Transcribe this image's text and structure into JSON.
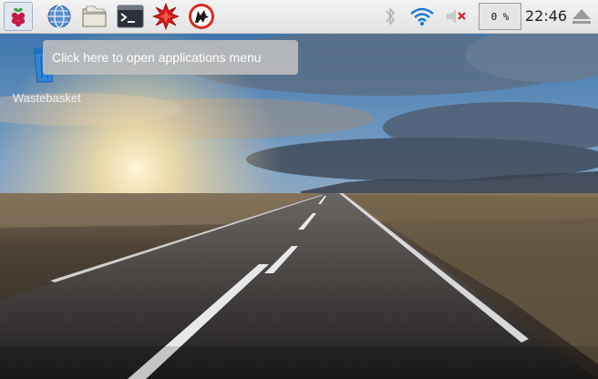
{
  "taskbar": {
    "launchers": [
      {
        "name": "raspberry-menu-icon"
      },
      {
        "name": "web-browser-icon"
      },
      {
        "name": "file-manager-icon"
      },
      {
        "name": "terminal-icon"
      },
      {
        "name": "mathematica-icon"
      },
      {
        "name": "wolfram-icon"
      }
    ],
    "tray": {
      "bluetooth": "bluetooth-icon",
      "wifi": "wifi-icon",
      "volume": "volume-muted-icon",
      "cpu_usage": "0 %",
      "clock": "22:46",
      "eject": "eject-icon"
    },
    "accent": "#1b7ad6"
  },
  "tooltip": {
    "text": "Click here to open applications menu"
  },
  "desktop": {
    "icons": [
      {
        "label": "Wastebasket",
        "icon": "trash-icon"
      }
    ]
  }
}
